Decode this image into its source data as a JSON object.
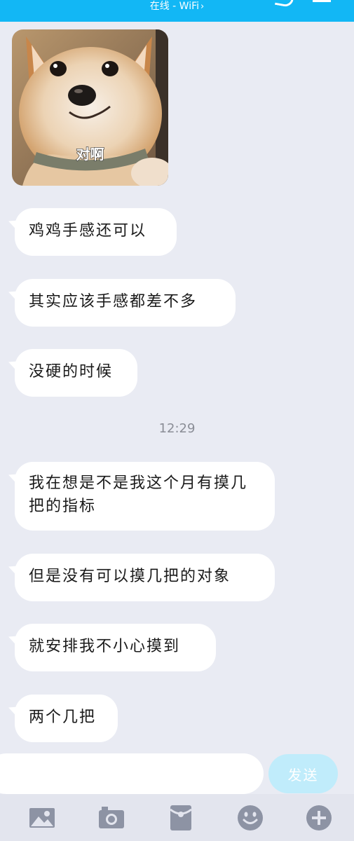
{
  "status": {
    "text": "在线 - WiFi",
    "chevron": "›"
  },
  "sticker": {
    "caption": "对啊",
    "description_icon": "shiba-dog-sticker"
  },
  "messages": [
    {
      "text": "鸡鸡手感还可以"
    },
    {
      "text": "其实应该手感都差不多"
    },
    {
      "text": "没硬的时候"
    },
    {
      "text": "我在想是不是我这个月有摸几把的指标"
    },
    {
      "text": "但是没有可以摸几把的对象"
    },
    {
      "text": "就安排我不小心摸到"
    },
    {
      "text": "两个几把"
    }
  ],
  "timestamp": "12:29",
  "input": {
    "value": "",
    "placeholder": ""
  },
  "send_label": "发送",
  "toolbar": {
    "icons": [
      "image-icon",
      "camera-icon",
      "red-packet-icon",
      "emoji-icon",
      "plus-icon"
    ]
  },
  "colors": {
    "accent": "#12b7f5",
    "background": "#e9ebf3",
    "send_disabled": "#c0ecfb",
    "icon": "#8d93a4"
  }
}
